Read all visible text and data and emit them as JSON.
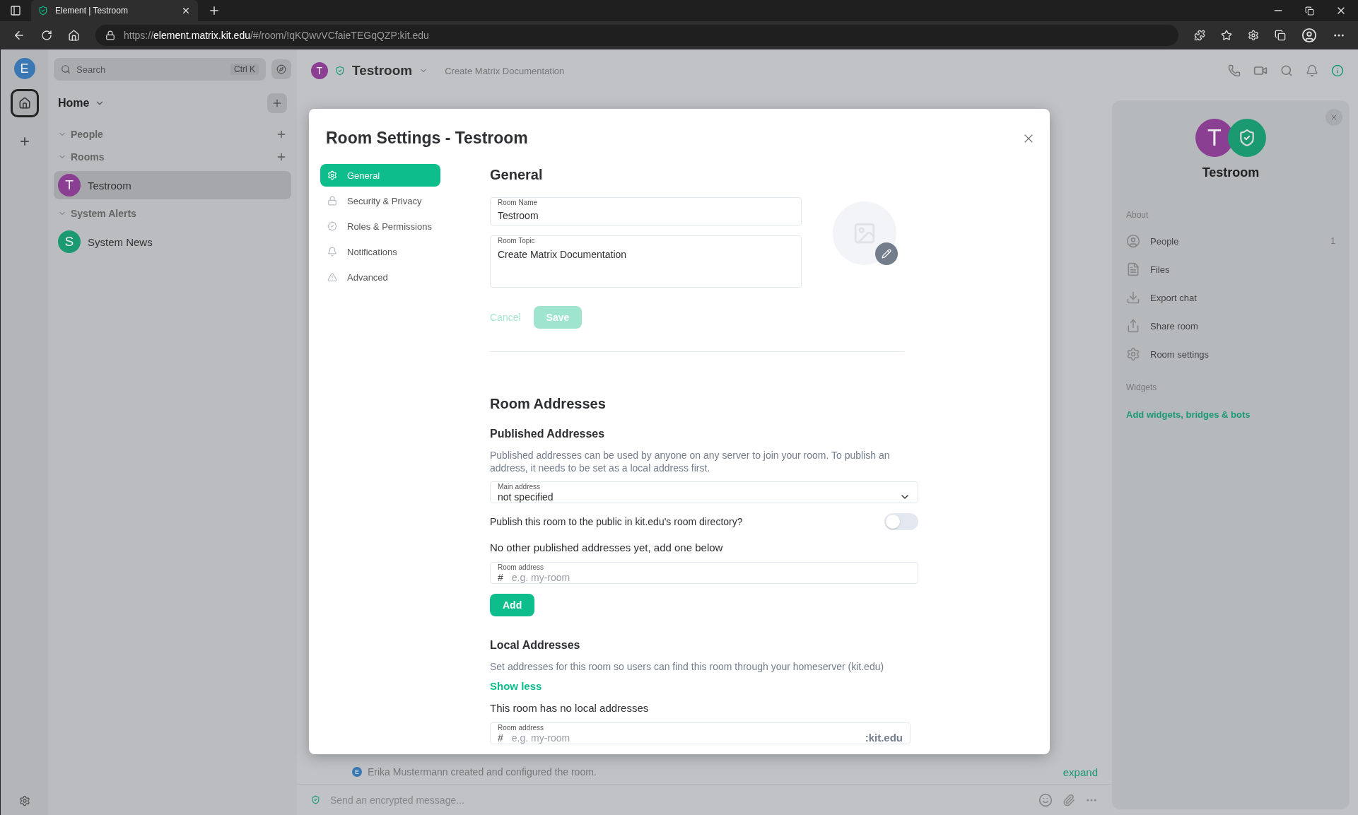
{
  "browser": {
    "tab_title": "Element | Testroom",
    "url": "https://**element.matrix.kit.edu**/#/room/!qKQwvVCfaieTEGqQZP:kit.edu"
  },
  "spaces": {
    "avatar": "E",
    "items": [
      {
        "kind": "home",
        "selected": true
      },
      {
        "kind": "create",
        "selected": false
      }
    ]
  },
  "room_list": {
    "search_placeholder": "Search",
    "search_shortcut": "Ctrl K",
    "home_title": "Home",
    "sections": [
      {
        "title": "People",
        "expanded": true,
        "can_add": true
      },
      {
        "title": "Rooms",
        "expanded": true,
        "can_add": true,
        "rooms": [
          {
            "name": "Testroom",
            "avatar": "T",
            "color": "#8a3f92",
            "selected": true
          }
        ]
      },
      {
        "title": "System Alerts",
        "expanded": true,
        "can_add": false,
        "rooms": [
          {
            "name": "System News",
            "avatar": "S",
            "color": "#1b9a71",
            "selected": false
          }
        ]
      }
    ]
  },
  "room_header": {
    "avatar": "T",
    "name": "Testroom",
    "topic": "Create Matrix Documentation"
  },
  "timeline": {
    "avatar": "E",
    "event": "Erika Mustermann created and configured the room.",
    "expand": "expand"
  },
  "composer": {
    "placeholder": "Send an encrypted message..."
  },
  "right_panel": {
    "avatar": "T",
    "name": "Testroom",
    "about_title": "About",
    "items": [
      {
        "label": "People",
        "count": "1"
      },
      {
        "label": "Files"
      },
      {
        "label": "Export chat"
      },
      {
        "label": "Share room"
      },
      {
        "label": "Room settings"
      }
    ],
    "widgets_title": "Widgets",
    "widgets_link": "Add widgets, bridges & bots"
  },
  "dialog": {
    "title": "Room Settings - Testroom",
    "tabs": [
      {
        "label": "General",
        "selected": true
      },
      {
        "label": "Security & Privacy",
        "selected": false
      },
      {
        "label": "Roles & Permissions",
        "selected": false
      },
      {
        "label": "Notifications",
        "selected": false
      },
      {
        "label": "Advanced",
        "selected": false
      }
    ],
    "general": {
      "title": "General",
      "room_name_label": "Room Name",
      "room_name": "Testroom",
      "room_topic_label": "Room Topic",
      "room_topic": "Create Matrix Documentation",
      "cancel": "Cancel",
      "save": "Save",
      "save_disabled": true
    },
    "addresses": {
      "title": "Room Addresses",
      "published_title": "Published Addresses",
      "published_desc": "Published addresses can be used by anyone on any server to join your room. To publish an address, it needs to be set as a local address first.",
      "main_address_label": "Main address",
      "main_address": "not specified",
      "publish_label": "Publish this room to the public in kit.edu's room directory?",
      "publish_on": false,
      "no_published": "No other published addresses yet, add one below",
      "room_address_label": "Room address",
      "room_address_prefix": "#",
      "room_address_placeholder": "e.g. my-room",
      "add": "Add",
      "local_title": "Local Addresses",
      "local_desc": "Set addresses for this room so users can find this room through your homeserver (kit.edu)",
      "show_less": "Show less",
      "no_local": "This room has no local addresses",
      "local_address_label": "Room address",
      "local_address_prefix": "#",
      "local_address_placeholder": "e.g. my-room",
      "local_address_suffix": ":kit.edu"
    }
  }
}
